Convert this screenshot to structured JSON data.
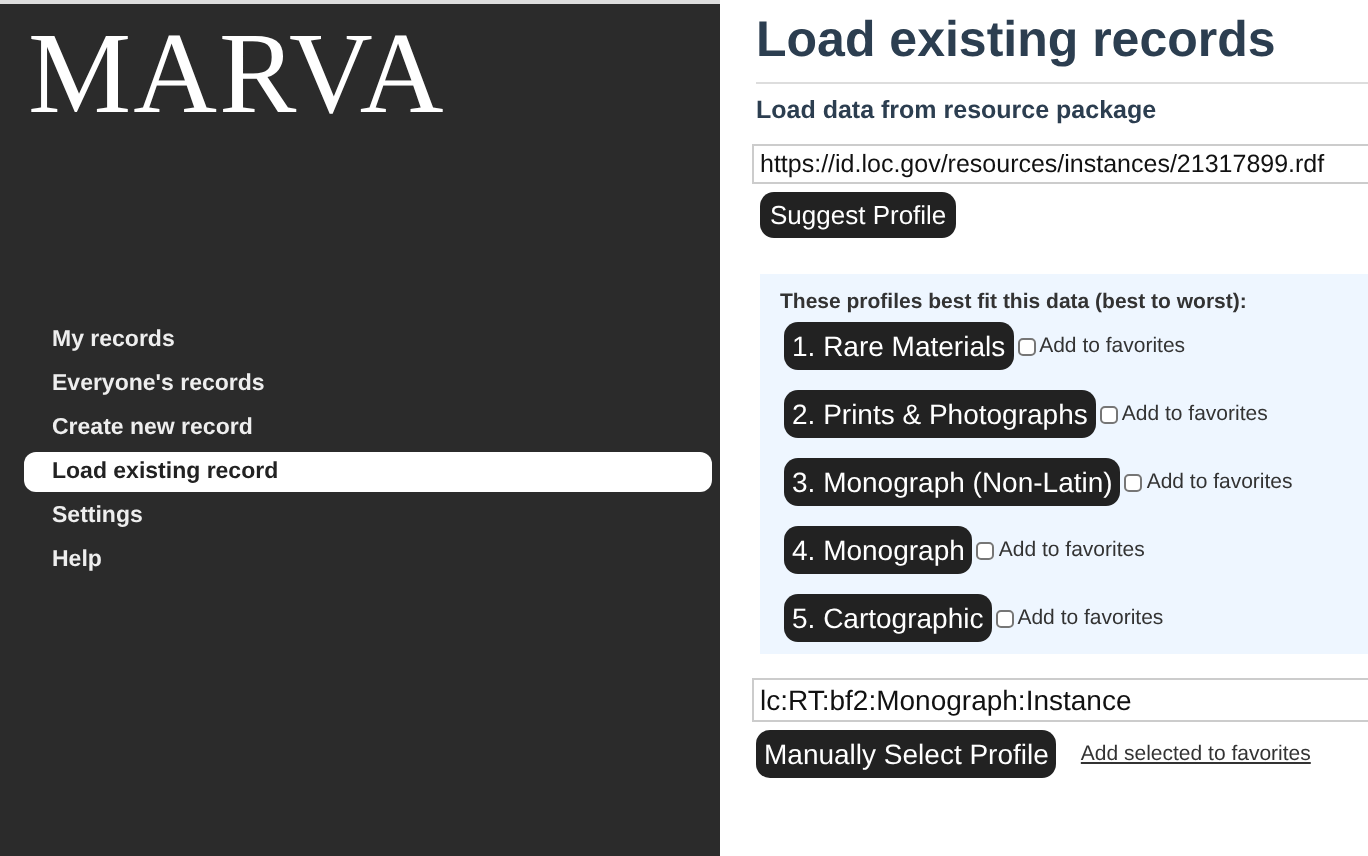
{
  "logo": "MARVA",
  "sidebar": {
    "items": [
      {
        "label": "My records",
        "selected": false
      },
      {
        "label": "Everyone's records",
        "selected": false
      },
      {
        "label": "Create new record",
        "selected": false
      },
      {
        "label": "Load existing record",
        "selected": true
      },
      {
        "label": "Settings",
        "selected": false
      },
      {
        "label": "Help",
        "selected": false
      }
    ]
  },
  "main": {
    "title": "Load existing records",
    "subtitle": "Load data from resource package",
    "url_field": {
      "value": "https://id.loc.gov/resources/instances/21317899.rdf"
    },
    "suggest_button": "Suggest Profile",
    "suggestions": {
      "caption": "These profiles best fit this data (best to worst):",
      "profiles": [
        {
          "label": "1. Rare Materials",
          "favorite_label": "Add to favorites",
          "checked": false
        },
        {
          "label": "2. Prints & Photographs",
          "favorite_label": "Add to favorites",
          "checked": false
        },
        {
          "label": "3. Monograph (Non-Latin)",
          "favorite_label": "Add to favorites",
          "checked": false
        },
        {
          "label": "4. Monograph",
          "favorite_label": "Add to favorites",
          "checked": false
        },
        {
          "label": "5. Cartographic",
          "favorite_label": "Add to favorites",
          "checked": false
        }
      ]
    },
    "profile_field": {
      "value": "lc:RT:bf2:Monograph:Instance"
    },
    "manual_button": "Manually Select Profile",
    "add_favorites_link": "Add selected to favorites"
  }
}
